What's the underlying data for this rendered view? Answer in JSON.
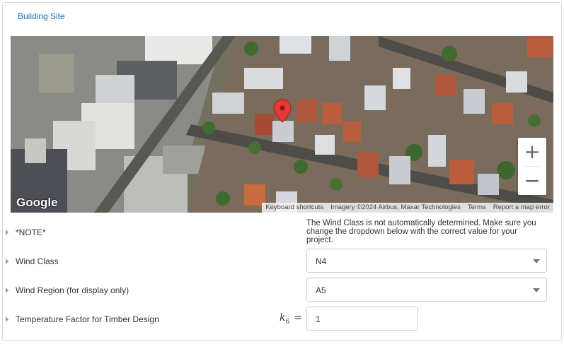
{
  "panel": {
    "title": "Building Site"
  },
  "map": {
    "logo": "Google",
    "zoom_in": "+",
    "zoom_out": "−",
    "attribution": [
      "Keyboard shortcuts",
      "Imagery ©2024 Airbus, Maxar Technologies",
      "Terms",
      "Report a map error"
    ],
    "marker_color": "#e53935"
  },
  "form": {
    "note": {
      "label": "*NOTE*",
      "text": "The Wind Class is not automatically determined. Make sure you change the dropdown below with the correct value for your project."
    },
    "wind_class": {
      "label": "Wind Class",
      "value": "N4"
    },
    "wind_region": {
      "label": "Wind Region (for display only)",
      "value": "A5"
    },
    "temperature": {
      "label": "Temperature Factor for Timber Design",
      "symbol": "k",
      "subscript": "6",
      "equals": "=",
      "value": "1"
    }
  },
  "colors": {
    "link": "#1a6fb0",
    "border": "#d9d9d9"
  }
}
